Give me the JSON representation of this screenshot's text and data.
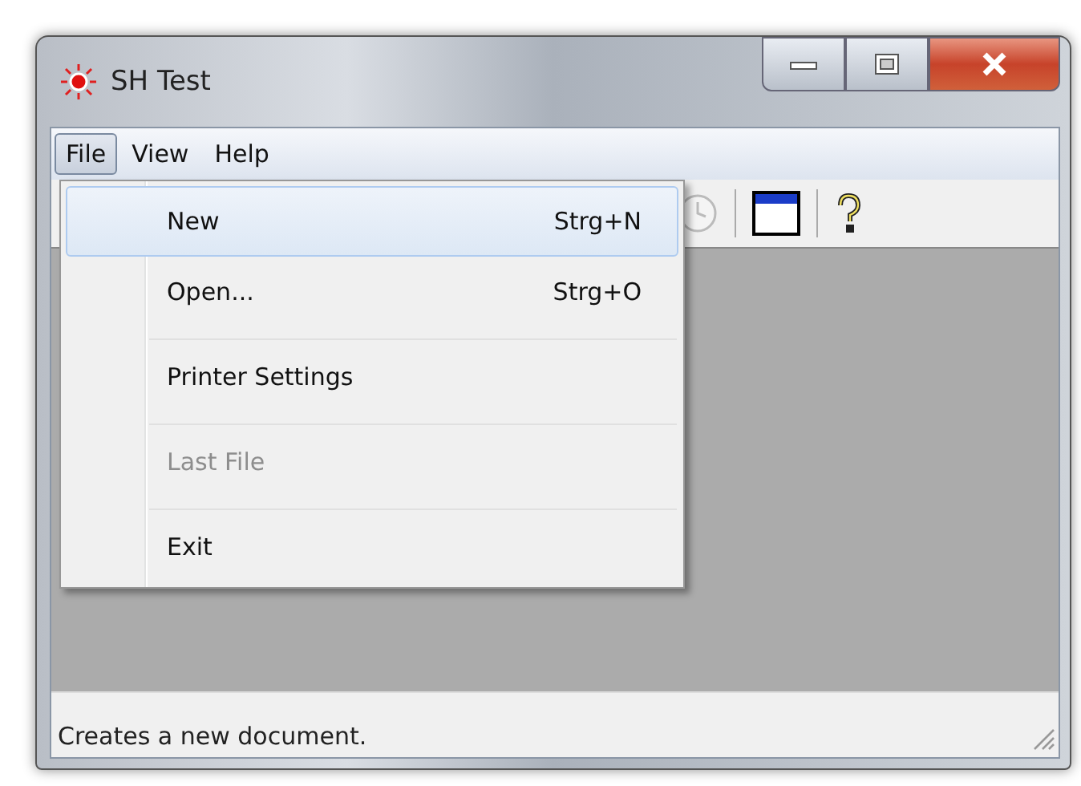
{
  "window": {
    "title": "SH Test"
  },
  "menu_bar": [
    {
      "label": "File",
      "selected": true
    },
    {
      "label": "View",
      "selected": false
    },
    {
      "label": "Help",
      "selected": false
    }
  ],
  "file_menu": [
    {
      "label": "New",
      "shortcut": "Strg+N",
      "selected": true,
      "disabled": false,
      "separator_after": false
    },
    {
      "label": "Open...",
      "shortcut": "Strg+O",
      "selected": false,
      "disabled": false,
      "separator_after": true
    },
    {
      "label": "Printer Settings",
      "selected": false,
      "disabled": false,
      "separator_after": true
    },
    {
      "label": "Last File",
      "selected": false,
      "disabled": true,
      "separator_after": true
    },
    {
      "label": "Exit",
      "selected": false,
      "disabled": false,
      "separator_after": false
    }
  ],
  "status_bar": {
    "text": "Creates a new document."
  }
}
